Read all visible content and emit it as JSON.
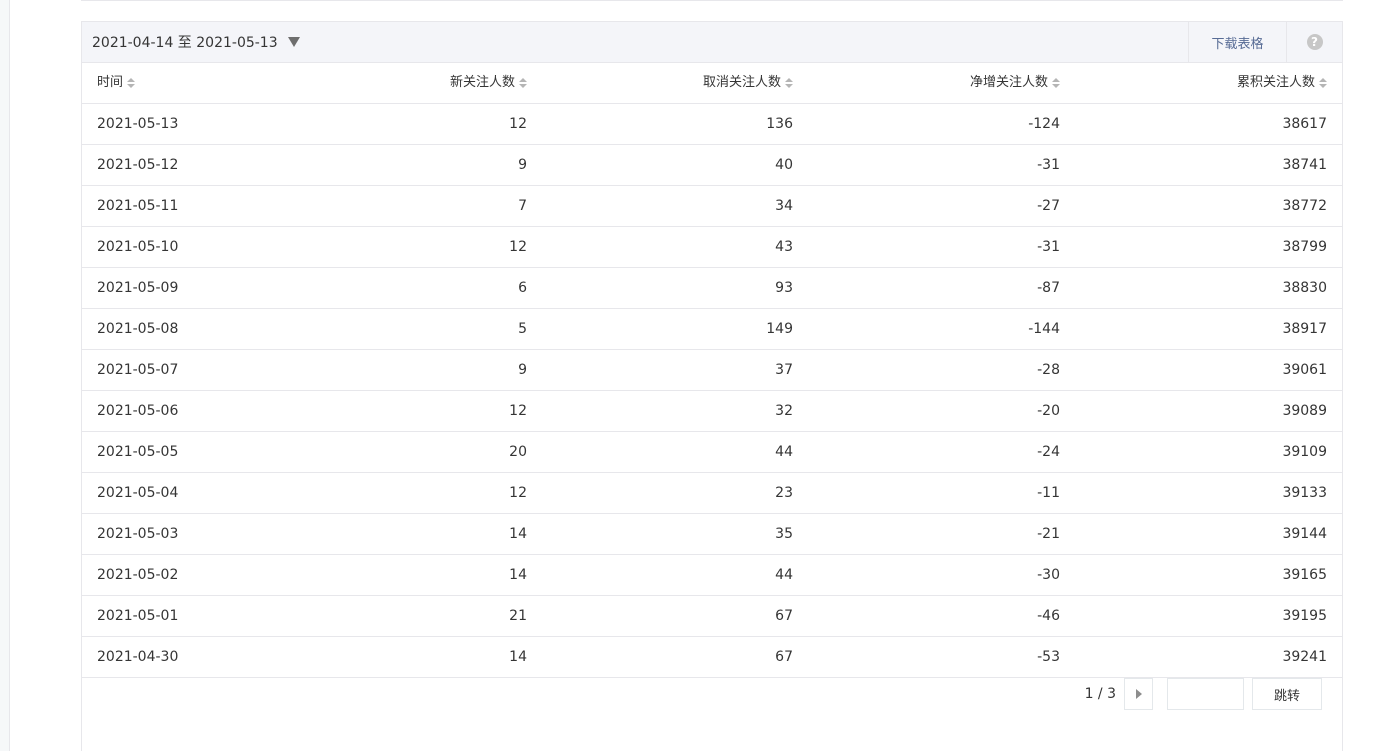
{
  "toolbar": {
    "date_range": "2021-04-14 至 2021-05-13",
    "download_label": "下载表格",
    "help_glyph": "?"
  },
  "table": {
    "headers": [
      "时间",
      "新关注人数",
      "取消关注人数",
      "净增关注人数",
      "累积关注人数"
    ],
    "rows": [
      [
        "2021-05-13",
        "12",
        "136",
        "-124",
        "38617"
      ],
      [
        "2021-05-12",
        "9",
        "40",
        "-31",
        "38741"
      ],
      [
        "2021-05-11",
        "7",
        "34",
        "-27",
        "38772"
      ],
      [
        "2021-05-10",
        "12",
        "43",
        "-31",
        "38799"
      ],
      [
        "2021-05-09",
        "6",
        "93",
        "-87",
        "38830"
      ],
      [
        "2021-05-08",
        "5",
        "149",
        "-144",
        "38917"
      ],
      [
        "2021-05-07",
        "9",
        "37",
        "-28",
        "39061"
      ],
      [
        "2021-05-06",
        "12",
        "32",
        "-20",
        "39089"
      ],
      [
        "2021-05-05",
        "20",
        "44",
        "-24",
        "39109"
      ],
      [
        "2021-05-04",
        "12",
        "23",
        "-11",
        "39133"
      ],
      [
        "2021-05-03",
        "14",
        "35",
        "-21",
        "39144"
      ],
      [
        "2021-05-02",
        "14",
        "44",
        "-30",
        "39165"
      ],
      [
        "2021-05-01",
        "21",
        "67",
        "-46",
        "39195"
      ],
      [
        "2021-04-30",
        "14",
        "67",
        "-53",
        "39241"
      ]
    ]
  },
  "pagination": {
    "page_info": "1 / 3",
    "jump_input_value": "",
    "jump_label": "跳转"
  },
  "icons": {
    "dropdown": "triangle-down-icon",
    "help": "question-circle-icon",
    "sort": "sort-icon",
    "next": "chevron-right-icon"
  },
  "colors": {
    "link": "#576b95",
    "toolbar_bg": "#f4f5f9",
    "border": "#e7e7eb"
  }
}
